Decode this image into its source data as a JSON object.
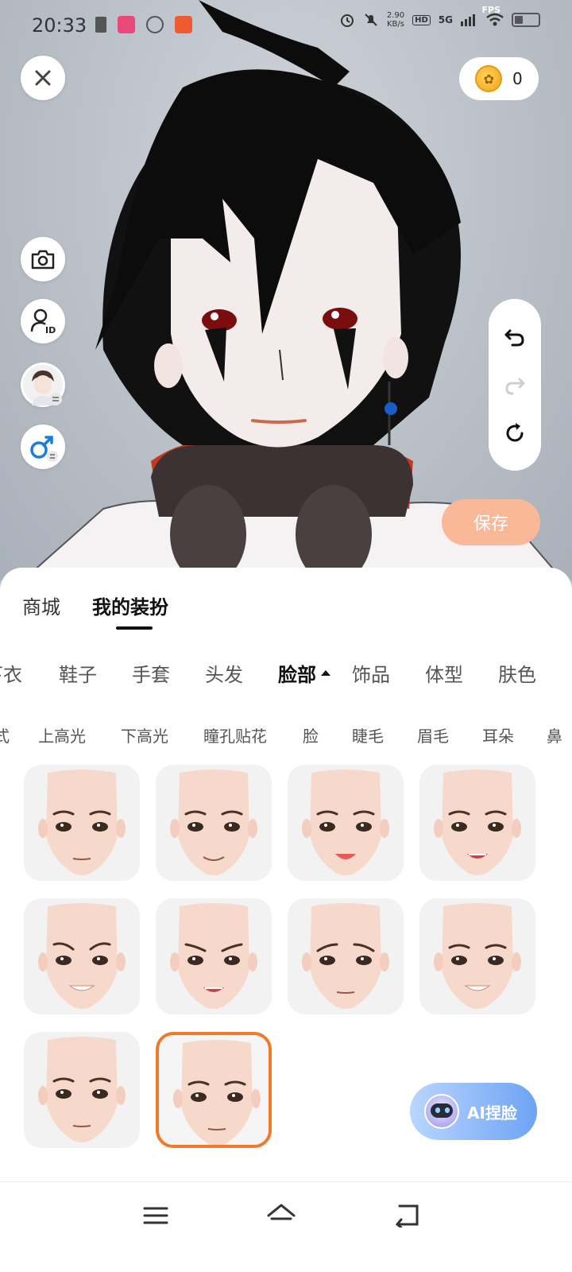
{
  "status_bar": {
    "time": "20:33",
    "fps_label": "FPS",
    "net_speed_value": "2.90",
    "net_speed_unit": "KB/s",
    "hd_badge": "HD",
    "network": "5G"
  },
  "coins": {
    "count": "0",
    "icon": "rabbit-coin-icon"
  },
  "save_label": "保存",
  "main_tabs": [
    {
      "label": "商城",
      "active": false
    },
    {
      "label": "我的装扮",
      "active": true
    }
  ],
  "categories": [
    "下衣",
    "鞋子",
    "手套",
    "头发",
    "脸部",
    "饰品",
    "体型",
    "肤色"
  ],
  "active_category": "脸部",
  "sub_categories": [
    "式",
    "上高光",
    "下高光",
    "瞳孔贴花",
    "脸",
    "睫毛",
    "眉毛",
    "耳朵",
    "鼻"
  ],
  "face_presets_count": 10,
  "selected_preset_index": 9,
  "ai_button_label": "AI捏脸",
  "colors": {
    "accent_orange": "#f07a2a",
    "save_button": "#f9b998",
    "ai_gradient_start": "#b9d6ff",
    "ai_gradient_end": "#6ea3f4"
  }
}
